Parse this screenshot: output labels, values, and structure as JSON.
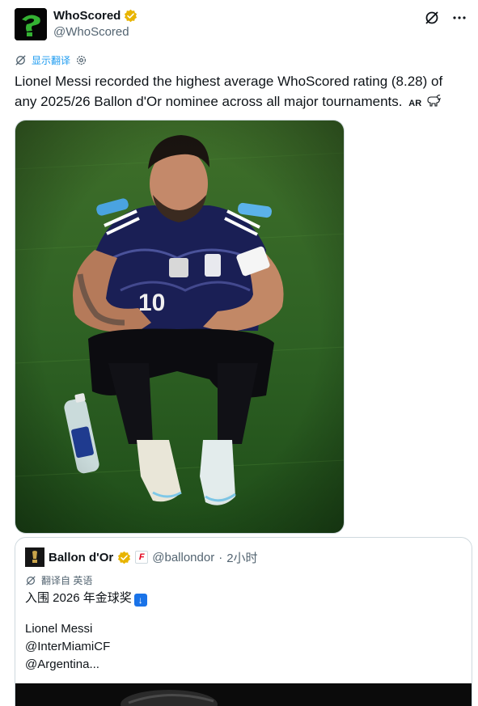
{
  "tweet": {
    "author": {
      "display_name": "WhoScored",
      "handle": "@WhoScored",
      "verified_color": "#e8b400"
    },
    "translate_label": "显示翻译",
    "text": "Lionel Messi recorded the highest average WhoScored rating (8.28) of any 2025/26 Ballon d'Or nominee across all major tournaments.",
    "text_suffix": "AR",
    "icons": [
      "grok-icon",
      "more-icon",
      "translate-icon",
      "settings-icon",
      "goat-emoji"
    ],
    "photo": {
      "shirt_number": "10"
    }
  },
  "quote": {
    "author": {
      "display_name": "Ballon d'Or",
      "affiliate_badge": "F",
      "handle": "@ballondor",
      "separator": "·",
      "time": "2小时"
    },
    "translated_label": "翻译自 英语",
    "lines": [
      "入围 2026 年金球奖",
      "",
      "Lionel Messi",
      "@InterMiamiCF",
      "@Argentina..."
    ]
  },
  "colors": {
    "link": "#1d9bf0",
    "secondary_text": "#536471",
    "border": "#cfd9de"
  }
}
